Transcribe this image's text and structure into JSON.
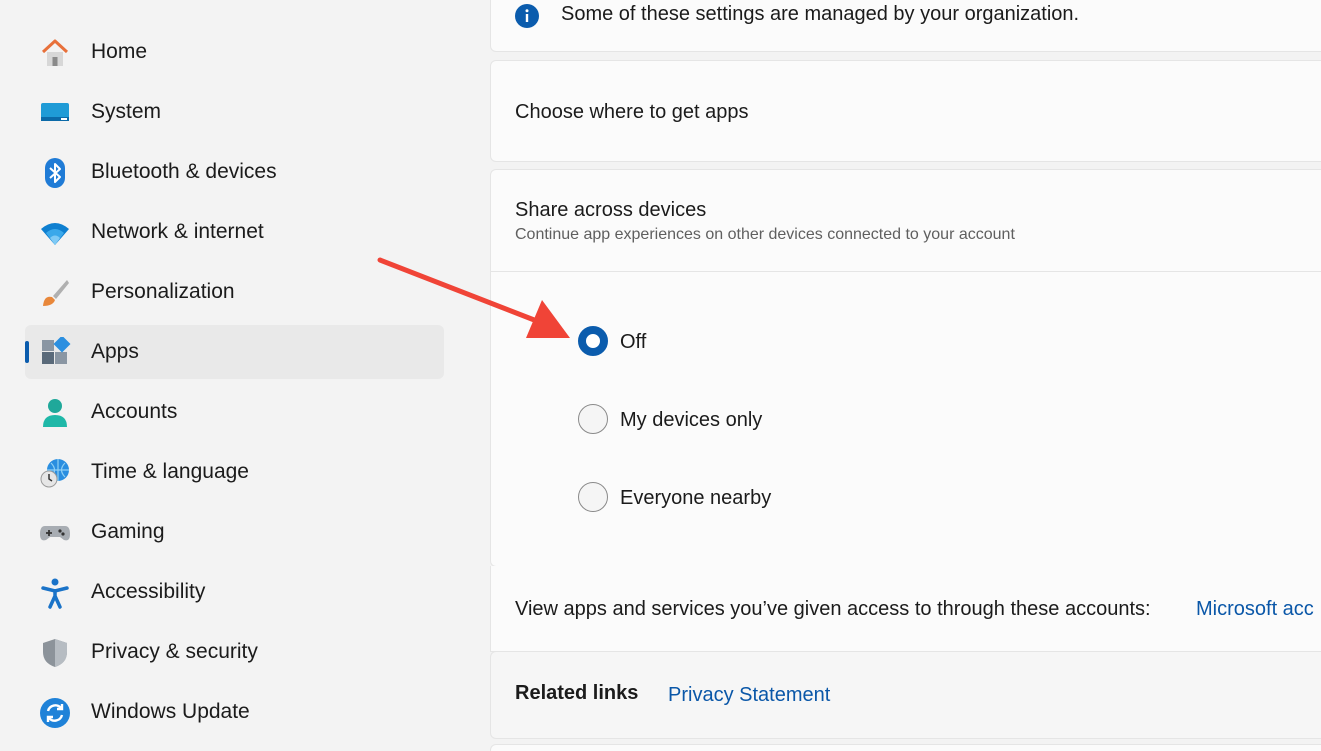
{
  "sidebar": {
    "items": [
      {
        "label": "Home",
        "icon": "home-icon"
      },
      {
        "label": "System",
        "icon": "system-icon"
      },
      {
        "label": "Bluetooth & devices",
        "icon": "bluetooth-icon"
      },
      {
        "label": "Network & internet",
        "icon": "wifi-icon"
      },
      {
        "label": "Personalization",
        "icon": "brush-icon"
      },
      {
        "label": "Apps",
        "icon": "apps-icon",
        "selected": true
      },
      {
        "label": "Accounts",
        "icon": "account-icon"
      },
      {
        "label": "Time & language",
        "icon": "globe-clock-icon"
      },
      {
        "label": "Gaming",
        "icon": "gamepad-icon"
      },
      {
        "label": "Accessibility",
        "icon": "accessibility-icon"
      },
      {
        "label": "Privacy & security",
        "icon": "shield-icon"
      },
      {
        "label": "Windows Update",
        "icon": "update-icon"
      }
    ]
  },
  "main": {
    "managed_notice": "Some of these settings are managed by your organization.",
    "choose_where": "Choose where to get apps",
    "share": {
      "title": "Share across devices",
      "subtitle": "Continue app experiences on other devices connected to your account",
      "options": [
        {
          "label": "Off",
          "checked": true
        },
        {
          "label": "My devices only",
          "checked": false
        },
        {
          "label": "Everyone nearby",
          "checked": false
        }
      ]
    },
    "view_apps_text": "View apps and services you’ve given access to through these accounts:",
    "microsoft_account_link": "Microsoft acc",
    "related_links": {
      "label": "Related links",
      "privacy_statement": "Privacy Statement"
    }
  },
  "colors": {
    "accent": "#0b5cad",
    "link": "#0a57a8",
    "arrow": "#f04437"
  }
}
